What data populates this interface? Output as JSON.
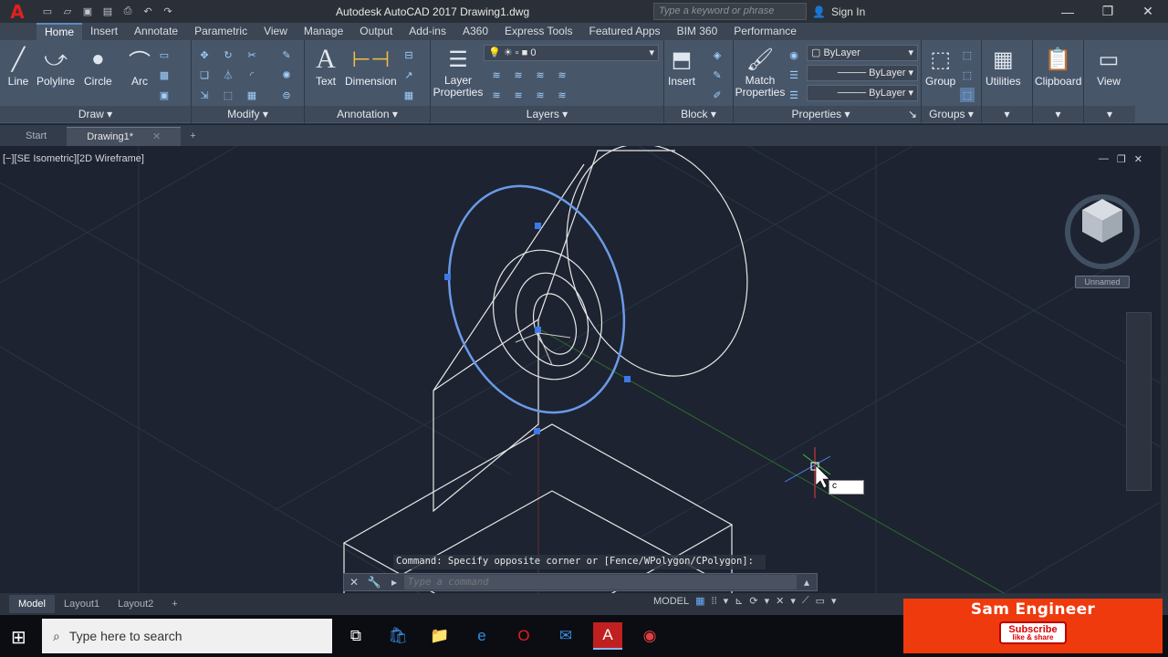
{
  "window": {
    "title": "Autodesk AutoCAD 2017    Drawing1.dwg",
    "search_placeholder": "Type a keyword or phrase",
    "signin": "Sign In"
  },
  "ribbon_tabs": [
    "Home",
    "Insert",
    "Annotate",
    "Parametric",
    "View",
    "Manage",
    "Output",
    "Add-ins",
    "A360",
    "Express Tools",
    "Featured Apps",
    "BIM 360",
    "Performance"
  ],
  "draw": {
    "line": "Line",
    "polyline": "Polyline",
    "circle": "Circle",
    "arc": "Arc",
    "title": "Draw"
  },
  "modify": {
    "title": "Modify"
  },
  "annotation": {
    "text": "Text",
    "dimension": "Dimension",
    "title": "Annotation"
  },
  "layers": {
    "layer_properties": "Layer Properties",
    "current_layer": "0",
    "title": "Layers"
  },
  "block": {
    "insert": "Insert",
    "title": "Block"
  },
  "properties": {
    "match": "Match Properties",
    "color": "ByLayer",
    "linetype": "ByLayer",
    "lineweight": "ByLayer",
    "title": "Properties"
  },
  "groups": {
    "group": "Group",
    "title": "Groups"
  },
  "utilities": {
    "label": "Utilities"
  },
  "clipboard": {
    "label": "Clipboard"
  },
  "view": {
    "label": "View"
  },
  "file_tabs": [
    "Start",
    "Drawing1*"
  ],
  "viewport": {
    "label": "[−][SE Isometric][2D Wireframe]",
    "viewcube_label": "Unnamed",
    "cursor_input": "c"
  },
  "command": {
    "history": "Command: Specify opposite corner or [Fence/WPolygon/CPolygon]:",
    "placeholder": "Type a command"
  },
  "layout_tabs": [
    "Model",
    "Layout1",
    "Layout2"
  ],
  "status": {
    "model": "MODEL"
  },
  "taskbar": {
    "search": "Type here to search"
  },
  "banner": {
    "name": "Sam Engineer",
    "subscribe": "Subscribe",
    "subline": "like & share"
  }
}
